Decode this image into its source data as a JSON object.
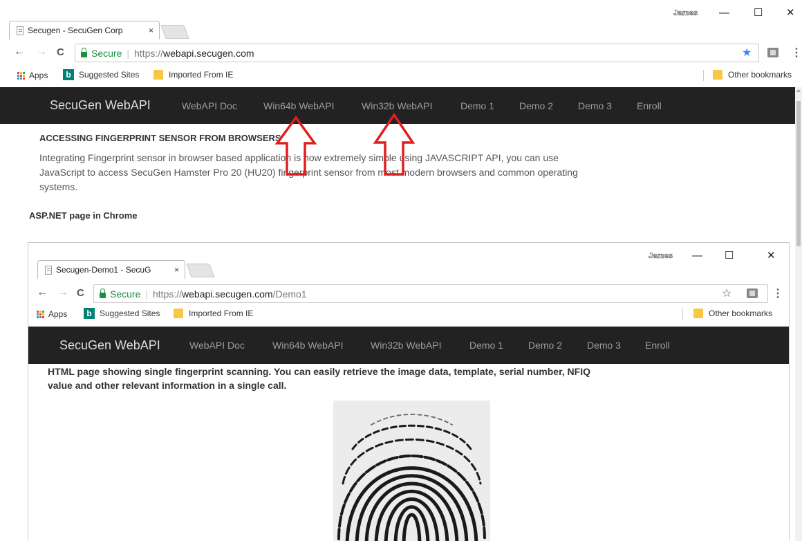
{
  "outer_browser": {
    "tab_title": "Secugen - SecuGen Corp",
    "tab_close": "×",
    "user_name": "James",
    "window_controls": {
      "minimize": "—",
      "maximize": "☐",
      "close": "✕"
    },
    "nav": {
      "back": "←",
      "forward": "→",
      "reload": "C"
    },
    "address": {
      "secure_label": "Secure",
      "separator": "|",
      "scheme": "https://",
      "host": "webapi.secugen.com",
      "path": ""
    },
    "star_icon": "★",
    "menu_icon": "⋮",
    "bookmarks": {
      "apps": "Apps",
      "suggested": "Suggested Sites",
      "imported": "Imported From IE",
      "other": "Other bookmarks"
    }
  },
  "site_nav": {
    "brand": "SecuGen WebAPI",
    "links": [
      "WebAPI Doc",
      "Win64b WebAPI",
      "Win32b WebAPI",
      "Demo 1",
      "Demo 2",
      "Demo 3",
      "Enroll"
    ]
  },
  "content": {
    "heading": "ACCESSING FINGERPRINT SENSOR FROM BROWSERS",
    "paragraph_lines": [
      "Integrating Fingerprint sensor in browser based application is now extremely simple using JAVASCRIPT API, you can use",
      "JavaScript to access SecuGen Hamster Pro 20 (HU20) fingerprint sensor from most modern browsers and common operating",
      "systems."
    ],
    "subheading": "ASP.NET page in Chrome"
  },
  "inner_browser": {
    "tab_title": "Secugen-Demo1 - SecuG",
    "tab_close": "×",
    "user_name": "James",
    "window_controls": {
      "minimize": "—",
      "maximize": "☐",
      "close": "✕"
    },
    "nav": {
      "back": "←",
      "forward": "→",
      "reload": "C"
    },
    "address": {
      "secure_label": "Secure",
      "separator": "|",
      "scheme": "https://",
      "host": "webapi.secugen.com",
      "path": "/Demo1"
    },
    "star_icon": "☆",
    "menu_icon": "⋮",
    "bookmarks": {
      "apps": "Apps",
      "suggested": "Suggested Sites",
      "imported": "Imported From IE",
      "other": "Other bookmarks"
    },
    "site_nav": {
      "brand": "SecuGen WebAPI",
      "links": [
        "WebAPI Doc",
        "Win64b WebAPI",
        "Win32b WebAPI",
        "Demo 1",
        "Demo 2",
        "Demo 3",
        "Enroll"
      ]
    },
    "description_lines": [
      "HTML page showing single fingerprint scanning. You can easily retrieve the image data, template, serial number, NFIQ",
      "value and other relevant information in a single call."
    ]
  },
  "colors": {
    "nav_bg": "#222222",
    "nav_link": "#9d9d9d",
    "annotation_arrow": "#e01e1e",
    "secure_green": "#1e8e3e",
    "star_blue": "#4285f4"
  }
}
